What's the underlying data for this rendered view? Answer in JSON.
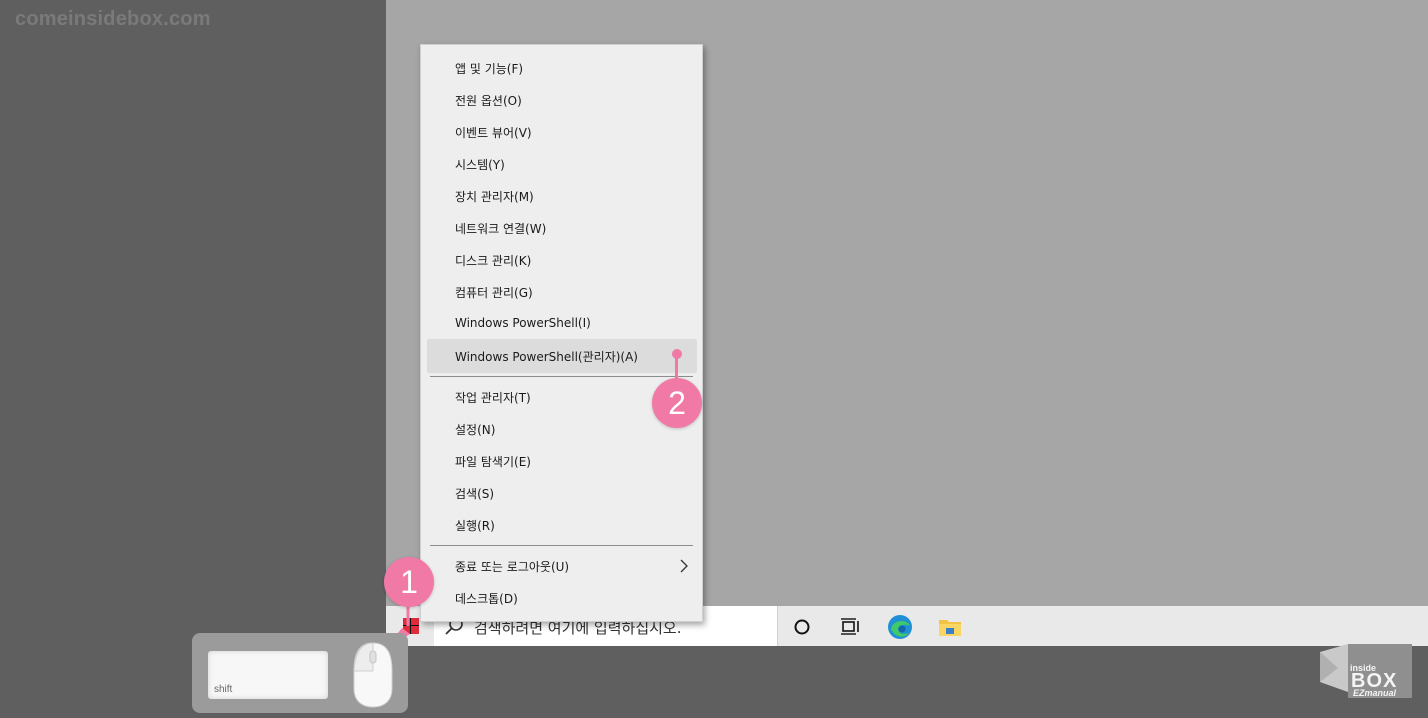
{
  "watermark": "comeinsidebox.com",
  "context_menu": {
    "group1": [
      {
        "label": "앱 및 기능(F)"
      },
      {
        "label": "전원 옵션(O)"
      },
      {
        "label": "이벤트 뷰어(V)"
      },
      {
        "label": "시스템(Y)"
      },
      {
        "label": "장치 관리자(M)"
      },
      {
        "label": "네트워크 연결(W)"
      },
      {
        "label": "디스크 관리(K)"
      },
      {
        "label": "컴퓨터 관리(G)"
      },
      {
        "label": "Windows PowerShell(I)"
      },
      {
        "label": "Windows PowerShell(관리자)(A)"
      }
    ],
    "group2": [
      {
        "label": "작업 관리자(T)"
      },
      {
        "label": "설정(N)"
      },
      {
        "label": "파일 탐색기(E)"
      },
      {
        "label": "검색(S)"
      },
      {
        "label": "실행(R)"
      }
    ],
    "group3": [
      {
        "label": "종료 또는 로그아웃(U)"
      },
      {
        "label": "데스크톱(D)"
      }
    ]
  },
  "taskbar": {
    "search_placeholder": "검색하려면 여기에 입력하십시오."
  },
  "annotations": {
    "step1": "1",
    "step2": "2"
  },
  "keyboard": {
    "shift_label": "shift"
  },
  "logo": {
    "top": "inside",
    "middle": "BOX",
    "bottom": "EZmanual"
  },
  "colors": {
    "accent_pink": "#f07aa5",
    "desktop": "#a6a6a6",
    "menu_bg": "#eeeeee",
    "taskbar_bg": "#e9e9e9"
  }
}
